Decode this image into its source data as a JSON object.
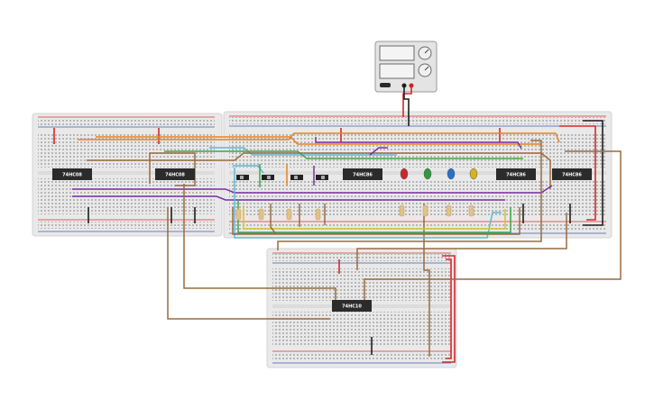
{
  "power_supply": {
    "display_top": "",
    "display_bottom": "",
    "switch_label": "",
    "terminals": [
      "negative",
      "positive"
    ]
  },
  "chips": [
    {
      "id": "u1",
      "label": "74HC08"
    },
    {
      "id": "u2",
      "label": "74HC08"
    },
    {
      "id": "u3",
      "label": "74HC86"
    },
    {
      "id": "u4",
      "label": "74HC86"
    },
    {
      "id": "u5",
      "label": "74HC86"
    },
    {
      "id": "u6",
      "label": "74HC10"
    }
  ],
  "leds": [
    {
      "name": "led-red",
      "color": "#c8282c"
    },
    {
      "name": "led-green",
      "color": "#2e9a3a"
    },
    {
      "name": "led-blue",
      "color": "#2a6fc9"
    },
    {
      "name": "led-yellow",
      "color": "#d7b21c"
    }
  ],
  "colors": {
    "breadboard": "#e9e9e9",
    "rail_red": "#d8302f",
    "rail_blue": "#3a5fb0",
    "wire_brown": "#9a6b3e",
    "wire_orange": "#e8821e",
    "wire_purple": "#7a2fa6",
    "wire_red": "#d8282a",
    "wire_black": "#1e1e1e",
    "wire_green": "#3aa847",
    "wire_cyan": "#5fb8d8",
    "wire_yellow": "#d8c22a",
    "chip_body": "#2b2b2b"
  }
}
